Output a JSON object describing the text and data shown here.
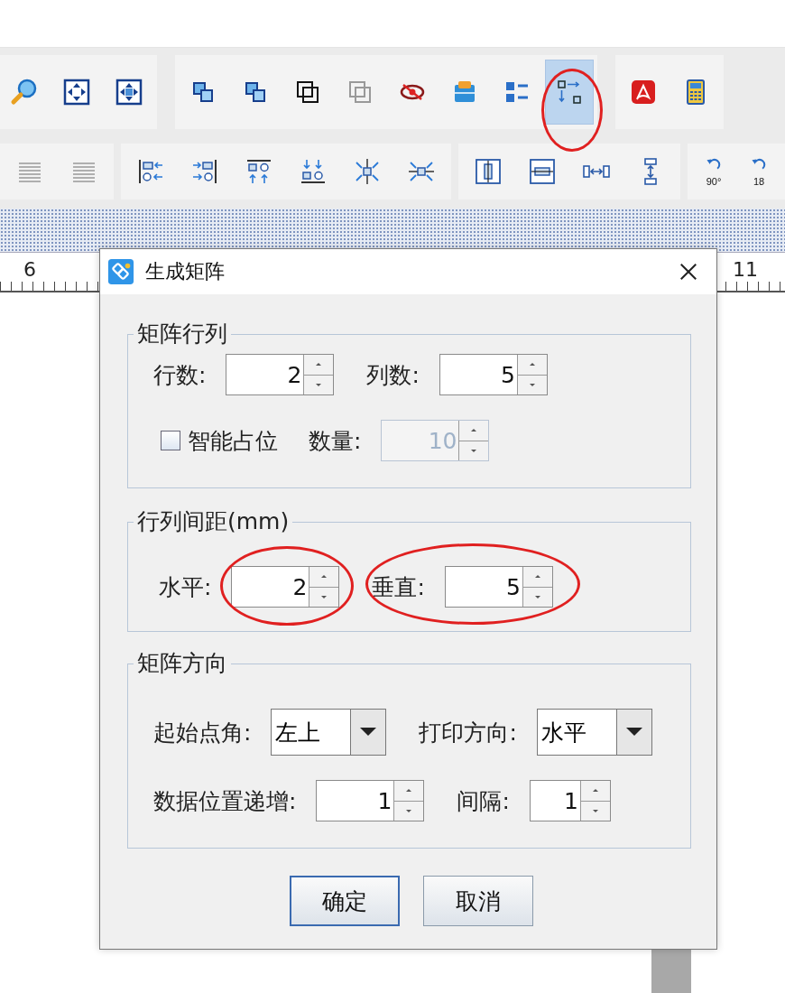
{
  "toolbar_rows": [
    {
      "groups": [
        {
          "items": [
            {
              "kind": "zoom",
              "selected": false
            },
            {
              "kind": "fit",
              "selected": false
            },
            {
              "kind": "fitpage",
              "selected": false
            }
          ]
        },
        {
          "items": [
            {
              "kind": "group",
              "selected": false
            },
            {
              "kind": "ungroup",
              "selected": false
            },
            {
              "kind": "frame",
              "selected": false
            },
            {
              "kind": "frameoff",
              "selected": false
            },
            {
              "kind": "hide",
              "selected": false
            },
            {
              "kind": "db",
              "selected": false
            },
            {
              "kind": "list",
              "selected": false
            },
            {
              "kind": "matrix",
              "selected": true
            }
          ]
        },
        {
          "items": [
            {
              "kind": "pdf",
              "selected": false
            },
            {
              "kind": "calc",
              "selected": false
            }
          ]
        }
      ]
    },
    {
      "groups": [
        {
          "items": [
            {
              "kind": "lines",
              "selected": false
            },
            {
              "kind": "lines",
              "selected": false
            }
          ]
        },
        {
          "items": [
            {
              "kind": "alignl",
              "selected": false
            },
            {
              "kind": "alignr",
              "selected": false
            },
            {
              "kind": "alignt",
              "selected": false
            },
            {
              "kind": "alignb",
              "selected": false
            },
            {
              "kind": "centerv",
              "selected": false
            },
            {
              "kind": "centerh",
              "selected": false
            }
          ]
        },
        {
          "items": [
            {
              "kind": "hcenter",
              "selected": false
            },
            {
              "kind": "vcenter",
              "selected": false
            },
            {
              "kind": "hdist",
              "selected": false
            },
            {
              "kind": "vdist",
              "selected": false
            }
          ]
        },
        {
          "items": [
            {
              "kind": "rotate",
              "label": "90°",
              "selected": false
            },
            {
              "kind": "rotate",
              "label": "18",
              "selected": false
            }
          ]
        }
      ]
    }
  ],
  "ruler": {
    "labels": [
      "6",
      "11"
    ]
  },
  "dialog": {
    "title": "生成矩阵",
    "sections": [
      {
        "title": "矩阵行列",
        "rows": [
          [
            {
              "kind": "spinner",
              "label": "行数:",
              "value": "2",
              "disabled": false
            },
            {
              "kind": "spinner",
              "label": "列数:",
              "value": "5",
              "disabled": false
            }
          ],
          [
            {
              "kind": "checkbox",
              "label": "智能占位",
              "checked": false
            },
            {
              "kind": "spinner",
              "label": "数量:",
              "value": "10",
              "disabled": true
            }
          ]
        ]
      },
      {
        "title": "行列间距(mm)",
        "rows": [
          [
            {
              "kind": "spinner",
              "label": "水平:",
              "value": "2",
              "disabled": false
            },
            {
              "kind": "spinner",
              "label": "垂直:",
              "value": "5",
              "disabled": false
            }
          ]
        ]
      },
      {
        "title": "矩阵方向",
        "rows": [
          [
            {
              "kind": "combo",
              "label": "起始点角:",
              "value": "左上"
            },
            {
              "kind": "combo",
              "label": "打印方向:",
              "value": "水平"
            }
          ],
          [
            {
              "kind": "spinner",
              "label": "数据位置递增:",
              "value": "1",
              "disabled": false
            },
            {
              "kind": "spinner",
              "label": "间隔:",
              "value": "1",
              "disabled": false
            }
          ]
        ]
      }
    ],
    "buttons": [
      {
        "label": "确定",
        "default": true
      },
      {
        "label": "取消",
        "default": false
      }
    ]
  }
}
